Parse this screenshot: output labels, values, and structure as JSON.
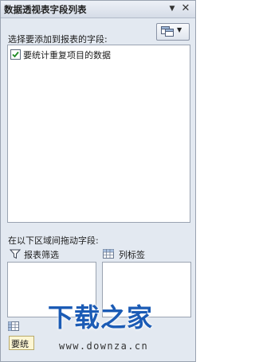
{
  "window": {
    "title": "数据透视表字段列表",
    "dropdown_icon": "caret-down-icon",
    "close_icon": "close-icon"
  },
  "field_section": {
    "label": "选择要添加到报表的字段:",
    "layout_button_icon": "field-layout-icon",
    "fields": [
      {
        "label": "要统计重复项目的数据",
        "checked": true
      }
    ]
  },
  "areas": {
    "drag_label": "在以下区域间拖动字段:",
    "report_filter": {
      "label": "报表筛选",
      "icon": "filter-icon"
    },
    "column_labels": {
      "label": "列标签",
      "icon": "column-grid-icon"
    },
    "row_labels": {
      "icon": "row-grid-icon"
    },
    "values_chip": {
      "label": "要统"
    }
  },
  "watermark": {
    "logo": "下载之家",
    "url": "www.downza.cn"
  },
  "colors": {
    "pane_background": "#e3e9f1",
    "border": "#9aa3b1",
    "watermark_blue": "#1b5bb5"
  }
}
